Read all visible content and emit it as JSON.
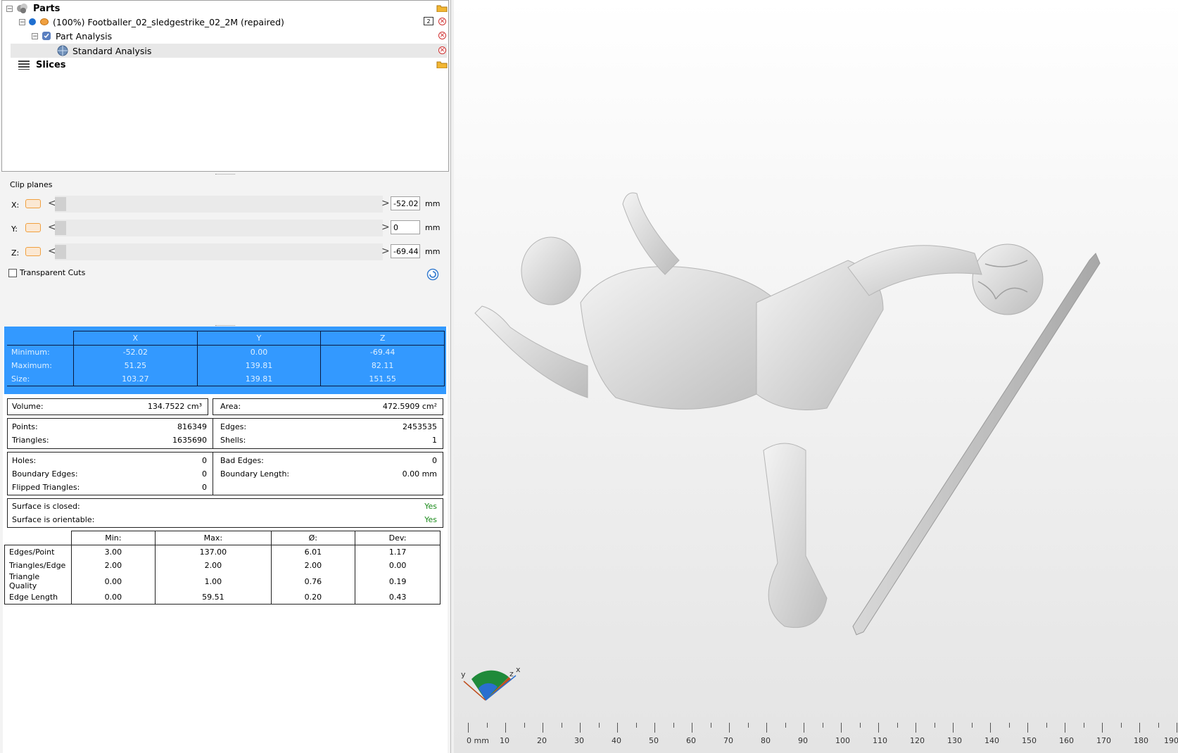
{
  "tree": {
    "parts_label": "Parts",
    "part_name": "(100%) Footballer_02_sledgestrike_02_2M (repaired)",
    "part_count_badge": "2",
    "analysis_label": "Part Analysis",
    "standard_analysis_label": "Standard Analysis",
    "slices_label": "Slices"
  },
  "clip": {
    "title": "Clip planes",
    "rows": [
      {
        "axis": "X:",
        "value": "-52.02",
        "unit": "mm"
      },
      {
        "axis": "Y:",
        "value": "0",
        "unit": "mm"
      },
      {
        "axis": "Z:",
        "value": "-69.44",
        "unit": "mm"
      }
    ],
    "transparent_cuts": "Transparent Cuts",
    "arrow_left": "<",
    "arrow_right": ">"
  },
  "bbox": {
    "headers": [
      "X",
      "Y",
      "Z"
    ],
    "rows": [
      {
        "label": "Minimum:",
        "values": [
          "-52.02",
          "0.00",
          "-69.44"
        ]
      },
      {
        "label": "Maximum:",
        "values": [
          "51.25",
          "139.81",
          "82.11"
        ]
      },
      {
        "label": "Size:",
        "values": [
          "103.27",
          "139.81",
          "151.55"
        ]
      }
    ]
  },
  "volume": {
    "label": "Volume:",
    "value": "134.7522 cm³"
  },
  "area": {
    "label": "Area:",
    "value": "472.5909 cm²"
  },
  "counts": {
    "points_label": "Points:",
    "points": "816349",
    "triangles_label": "Triangles:",
    "triangles": "1635690",
    "edges_label": "Edges:",
    "edges": "2453535",
    "shells_label": "Shells:",
    "shells": "1"
  },
  "defects": {
    "holes_label": "Holes:",
    "holes": "0",
    "boundary_edges_label": "Boundary Edges:",
    "boundary_edges": "0",
    "flipped_label": "Flipped Triangles:",
    "flipped": "0",
    "bad_edges_label": "Bad Edges:",
    "bad_edges": "0",
    "boundary_length_label": "Boundary Length:",
    "boundary_length": "0.00 mm"
  },
  "surface": {
    "closed_label": "Surface is closed:",
    "closed": "Yes",
    "orientable_label": "Surface is orientable:",
    "orientable": "Yes"
  },
  "quality": {
    "headers": [
      "Min:",
      "Max:",
      "Ø:",
      "Dev:"
    ],
    "rows": [
      {
        "label": "Edges/Point",
        "values": [
          "3.00",
          "137.00",
          "6.01",
          "1.17"
        ]
      },
      {
        "label": "Triangles/Edge",
        "values": [
          "2.00",
          "2.00",
          "2.00",
          "0.00"
        ]
      },
      {
        "label": "Triangle Quality",
        "values": [
          "0.00",
          "1.00",
          "0.76",
          "0.19"
        ]
      },
      {
        "label": "Edge Length",
        "values": [
          "0.00",
          "59.51",
          "0.20",
          "0.43"
        ]
      }
    ]
  },
  "axes_gizmo": {
    "x": "x",
    "y": "y",
    "z": "z"
  },
  "ruler": {
    "labels": [
      "0 mm",
      "10",
      "20",
      "30",
      "40",
      "50",
      "60",
      "70",
      "80",
      "90",
      "100",
      "110",
      "120",
      "130",
      "140",
      "150",
      "160",
      "170",
      "180",
      "190"
    ]
  },
  "colors": {
    "selection_blue": "#3399ff",
    "plane_orange": "#f0a040",
    "yes_green": "#1a8a1a",
    "delete_red": "#d03030"
  }
}
